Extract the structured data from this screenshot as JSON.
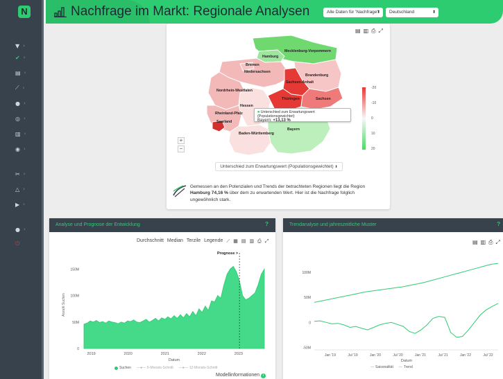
{
  "header": {
    "title": "Nachfrage im Markt: Regionale Analysen",
    "data_select": "Alle Daten für 'Nachfrage'",
    "region_select": "Deutschland",
    "logo": "N"
  },
  "sidebar": {
    "icons": [
      "filter-icon",
      "check-icon",
      "calculator-icon",
      "chart-icon",
      "location-icon",
      "target-icon",
      "barcode-icon",
      "eye-icon",
      "tools-icon",
      "triangle-icon",
      "play-icon",
      "user-icon",
      "power-icon"
    ]
  },
  "map": {
    "tool_icons": [
      "file-icon",
      "file-pdf-icon",
      "print-icon",
      "expand-icon"
    ],
    "regions": {
      "hamburg": "Hamburg",
      "mv": "Mecklenburg-Vorpommern",
      "bremen": "Bremen",
      "niedersachsen": "Niedersachsen",
      "brandenburg": "Brandenburg",
      "sachsen_anhalt": "Sachsen-Anhalt",
      "nrw": "Nordrhein-Westfalen",
      "thueringen": "Thüringen",
      "sachsen": "Sachsen",
      "hessen": "Hessen",
      "rlp": "Rheinland-Pfalz",
      "saarland": "Saarland",
      "bayern": "Bayern",
      "bw": "Baden-Württemberg"
    },
    "legend_ticks": [
      "-20",
      "-10",
      "0",
      "10",
      "20"
    ],
    "tooltip_title": "Unterschied zum Erwartungswert (Populationsgewichtet)",
    "tooltip_region": "Bayern:",
    "tooltip_value": "+13,13 %",
    "zoom_in": "+",
    "zoom_out": "−",
    "metric_select": "Unterschied zum Erwartungswert (Populationsgewichtet)",
    "summary_before": "Gemessen an den Potenzialen und Trends der betrachteten Regionen liegt die Region ",
    "summary_region": "Hamburg",
    "summary_value": "74,16 %",
    "summary_after": " über dem zu erwartenden Wert. Hier ist die Nachfrage folglich ungewöhnlich stark."
  },
  "colors": {
    "accent": "#2ecc71",
    "sidebar": "#38424d",
    "neg_strong": "#e53935",
    "pos_strong": "#4cd964"
  },
  "panel_left": {
    "title": "Analyse und Prognose der Entwicklung",
    "help": "?",
    "menu": [
      "Durchschnitt",
      "Median",
      "Terzile",
      "Legende"
    ],
    "forecast_label": "Prognose >",
    "footer_link": "Modellinformationen",
    "legend": [
      "Suchen",
      "6-Monats-Schnitt",
      "12-Monats-Schnitt"
    ]
  },
  "panel_right": {
    "title": "Trendanalyse und jahreszeitliche Muster",
    "help": "?",
    "legend": [
      "Saisonalität",
      "Trend"
    ]
  },
  "chart_data": [
    {
      "type": "area",
      "ylabel": "Anzahl Suchen",
      "xlabel": "Datum",
      "yticks": [
        "150M",
        "100M",
        "50M",
        "0"
      ],
      "xticks": [
        "2019",
        "2020",
        "2021",
        "2022",
        "2023"
      ],
      "ylim": [
        0,
        170
      ],
      "x_start_year": 2018.8,
      "series": [
        {
          "name": "Suchen",
          "values": [
            46,
            48,
            52,
            50,
            53,
            49,
            51,
            48,
            52,
            50,
            49,
            47,
            50,
            48,
            52,
            51,
            54,
            50,
            49,
            52,
            55,
            50,
            53,
            57,
            52,
            58,
            55,
            60,
            56,
            62,
            57,
            64,
            58,
            66,
            60,
            70,
            62,
            75,
            68,
            80,
            72,
            90,
            88,
            100,
            95,
            120,
            140,
            150,
            155,
            145,
            128,
            100,
            92,
            95,
            100,
            105,
            120,
            140,
            150
          ]
        }
      ]
    },
    {
      "type": "line",
      "xlabel": "Datum",
      "yticks": [
        "100M",
        "50M",
        "0",
        "-50M"
      ],
      "xticks": [
        "Jan '19",
        "Jul '19",
        "Jan '20",
        "Jul '20",
        "Jan '21",
        "Jul '21",
        "Jan '22",
        "Jul '22"
      ],
      "ylim": [
        -55,
        125
      ],
      "series": [
        {
          "name": "Saisonalität",
          "values": [
            2,
            3,
            0,
            -3,
            -2,
            -5,
            -10,
            -8,
            -12,
            -15,
            -10,
            -5,
            -2,
            0,
            -4,
            -8,
            -18,
            -22,
            -15,
            -5,
            8,
            12,
            10,
            -20,
            -30,
            -28,
            -15,
            0,
            15,
            25,
            32,
            38
          ]
        },
        {
          "name": "Trend",
          "values": [
            40,
            43,
            46,
            49,
            52,
            55,
            58,
            61,
            63,
            65,
            67,
            69,
            71,
            74,
            77,
            80,
            84,
            88,
            92,
            96,
            100,
            104,
            108,
            112,
            116,
            118
          ]
        }
      ]
    }
  ]
}
